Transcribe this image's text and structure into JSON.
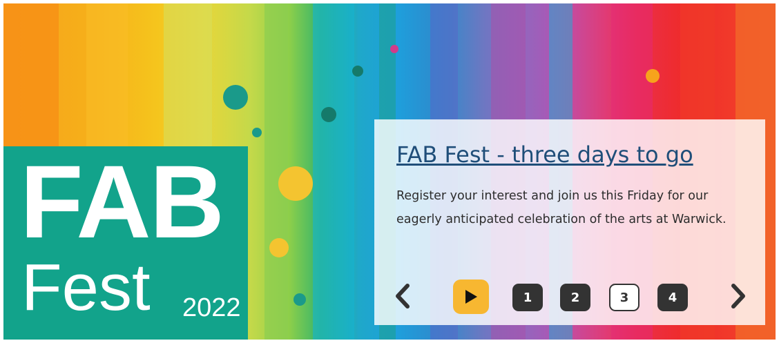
{
  "banner": {
    "logo": {
      "fab": "FAB",
      "fest": "Fest",
      "year": "2022"
    },
    "colors": {
      "logo_bg": "#12a38b",
      "link": "#1f4e79",
      "play": "#f7b731",
      "page_button": "#333333"
    }
  },
  "slide": {
    "title": "FAB Fest - three days to go",
    "description": "Register your interest and join us this Friday for our eagerly anticipated celebration of the arts at Warwick."
  },
  "carousel": {
    "prev_icon": "chevron-left-icon",
    "play_icon": "play-icon",
    "next_icon": "chevron-right-icon",
    "pages": [
      "1",
      "2",
      "3",
      "4"
    ],
    "active_page": "3"
  }
}
